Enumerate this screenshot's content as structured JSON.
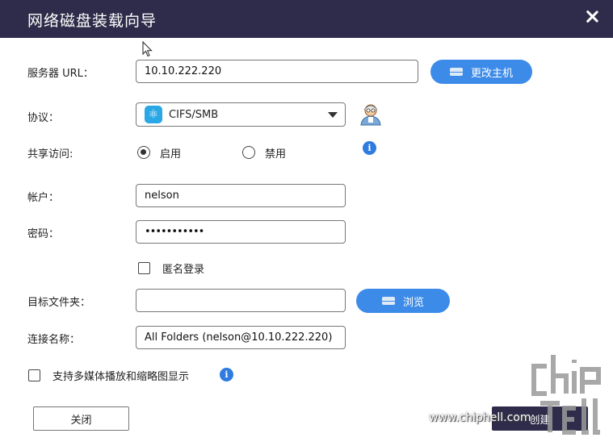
{
  "window": {
    "title": "网络磁盘装载向导"
  },
  "form": {
    "server_url_label": "服务器 URL：",
    "server_url_value": "10.10.222.220",
    "change_host_label": "更改主机",
    "protocol_label": "协议：",
    "protocol_value": "CIFS/SMB",
    "share_access_label": "共享访问:",
    "enable_label": "启用",
    "disable_label": "禁用",
    "account_label": "帐户：",
    "account_value": "nelson",
    "password_label": "密码：",
    "password_value": "•••••••••••",
    "anonymous_label": "匿名登录",
    "target_folder_label": "目标文件夹：",
    "target_folder_value": "",
    "browse_label": "浏览",
    "connection_name_label": "连接名称：",
    "connection_name_value": "All Folders (nelson@10.10.222.220)",
    "multimedia_label": "支持多媒体播放和缩略图显示"
  },
  "footer": {
    "close_label": "关闭",
    "create_label": "创建"
  },
  "watermark": {
    "text": "www.chiphell.com"
  },
  "colors": {
    "titlebar": "#2e2c4a",
    "accent": "#3d8be8",
    "info": "#2e7ce0"
  },
  "icons": [
    "close-icon",
    "host-icon",
    "smb-icon",
    "dropdown-arrow-icon",
    "wizard-icon",
    "info-icon",
    "mouse-cursor-icon"
  ]
}
